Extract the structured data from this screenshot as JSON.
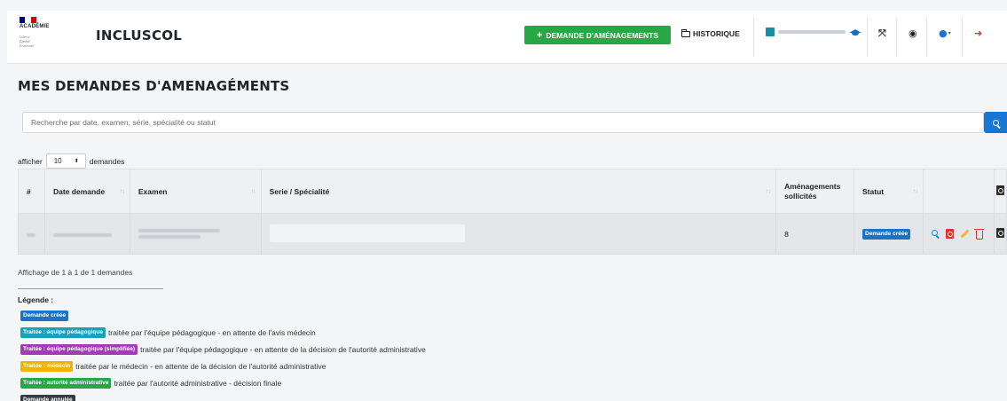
{
  "header": {
    "brand": {
      "flag_colors": [
        "#000091",
        "#ffffff",
        "#e1000f"
      ],
      "academie": "ACADÉMIE",
      "motto": [
        "Liberté",
        "Égalité",
        "Fraternité"
      ]
    },
    "app_title": "INCLUSCOL",
    "new_request_label": "DEMANDE D'AMÉNAGEMENTS",
    "history_label": "HISTORIQUE",
    "icons": {
      "expand": "expand-arrows-icon",
      "eye": "eye-icon",
      "help": "question-circle-icon",
      "logout": "sign-out-icon"
    },
    "colors": {
      "green": "#28a745",
      "blue": "#1976d2"
    }
  },
  "page_title": "MES DEMANDES D'AMENAGÉMENTS",
  "search": {
    "placeholder": "Recherche par date, examen, série, spécialité ou statut"
  },
  "show": {
    "prefix": "afficher",
    "value": "10",
    "suffix": "demandes"
  },
  "table": {
    "headers": {
      "num": "#",
      "date": "Date demande",
      "exam": "Examen",
      "serie": "Serie / Spécialité",
      "amen": "Aménagements sollicités",
      "statut": "Statut"
    },
    "rows": [
      {
        "amenagements": "8",
        "statut": "Demande créée"
      }
    ]
  },
  "summary": "Affichage de 1 à 1 de 1 demandes",
  "legend": {
    "title": "Légende :",
    "items": [
      {
        "badge": "Demande créée",
        "color": "#1a73c9",
        "text": ""
      },
      {
        "badge": "Traitée : équipe pédagogique",
        "color": "#17a2b8",
        "text": "traitée par l'équipe pédagogique - en attente de l'avis médecin"
      },
      {
        "badge": "Traitée : équipe pédagogique (simplifiée)",
        "color": "#a23bb5",
        "text": "traitée par l'équipe pédagogique - en attente de la décision de l'autorité administrative"
      },
      {
        "badge": "Traitée : médecin",
        "color": "#f0b400",
        "text": "traitée par le médecin - en attente de la décision de l'autorité administrative"
      },
      {
        "badge": "Traitée : autorité administrative",
        "color": "#28a745",
        "text": "traitée par l'autorité administrative - décision finale"
      },
      {
        "badge": "Demande annulée",
        "color": "#343a40",
        "text": ""
      }
    ]
  }
}
